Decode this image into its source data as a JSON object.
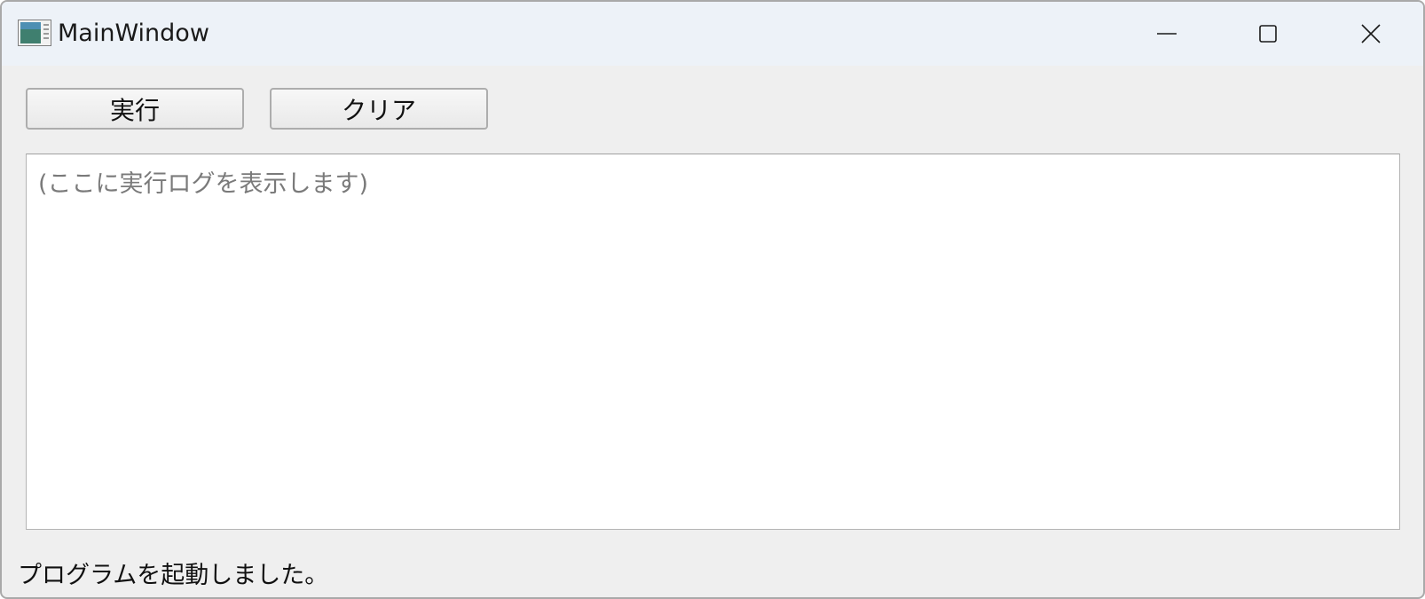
{
  "window": {
    "title": "MainWindow",
    "icon": "app-window-icon",
    "controls": {
      "minimize": "minimize-icon",
      "maximize": "maximize-icon",
      "close": "close-icon"
    }
  },
  "toolbar": {
    "run_label": "実行",
    "clear_label": "クリア"
  },
  "log": {
    "placeholder": "(ここに実行ログを表示します)"
  },
  "status": {
    "text": "プログラムを起動しました。"
  },
  "colors": {
    "titlebar": "#edf2f8",
    "window_bg": "#efefef",
    "log_bg": "#ffffff",
    "placeholder": "#7a7a7a"
  }
}
